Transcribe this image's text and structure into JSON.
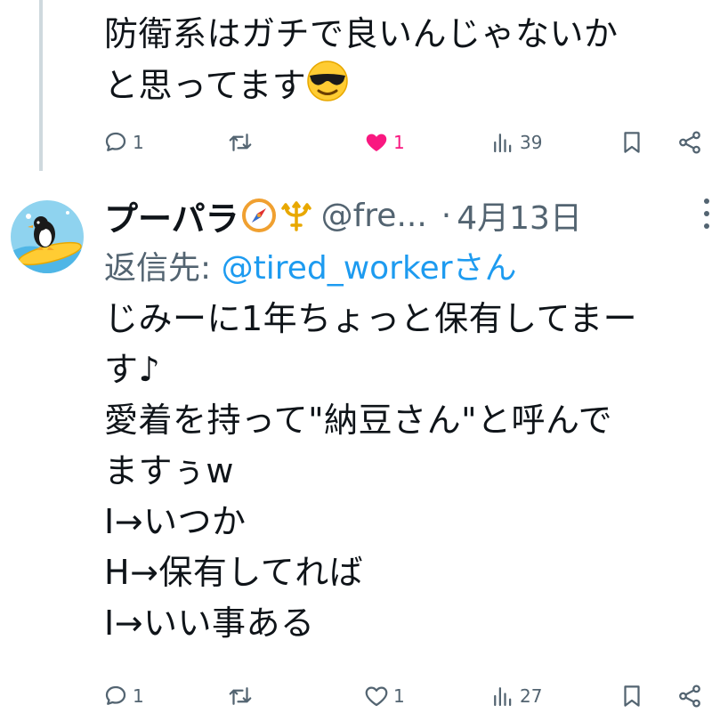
{
  "tweet1": {
    "text": "防衛系はガチで良いんじゃないか\nと思ってます",
    "emoji": "smiling-face-with-sunglasses",
    "replies": "1",
    "retweets": "",
    "likes": "1",
    "views": "39",
    "liked": true
  },
  "tweet2": {
    "display_name": "プーパラ",
    "handle": "@fre...",
    "separator": "·",
    "date": "4月13日",
    "reply_prefix": "返信先: ",
    "reply_to": "@tired_worker",
    "reply_suffix": "さん",
    "text": "じみーに1年ちょっと保有してまー\nす♪\n愛着を持って\"納豆さん\"と呼んで\nますぅw\nI→いつか\nH→保有してれば\nI→いい事ある",
    "replies": "1",
    "retweets": "",
    "likes": "1",
    "views": "27",
    "liked": false
  },
  "colors": {
    "text": "#0f1419",
    "muted": "#536471",
    "link": "#1d9bf0",
    "like": "#f91880",
    "thread_line": "#cfd9de"
  },
  "icons": {
    "reply": "speech-bubble-icon",
    "retweet": "retweet-arrows-icon",
    "like": "heart-icon",
    "views": "bar-chart-icon",
    "bookmark": "bookmark-icon",
    "share": "share-icon",
    "more": "vertical-dots-icon",
    "badges": [
      "compass-icon",
      "trident-icon"
    ]
  }
}
